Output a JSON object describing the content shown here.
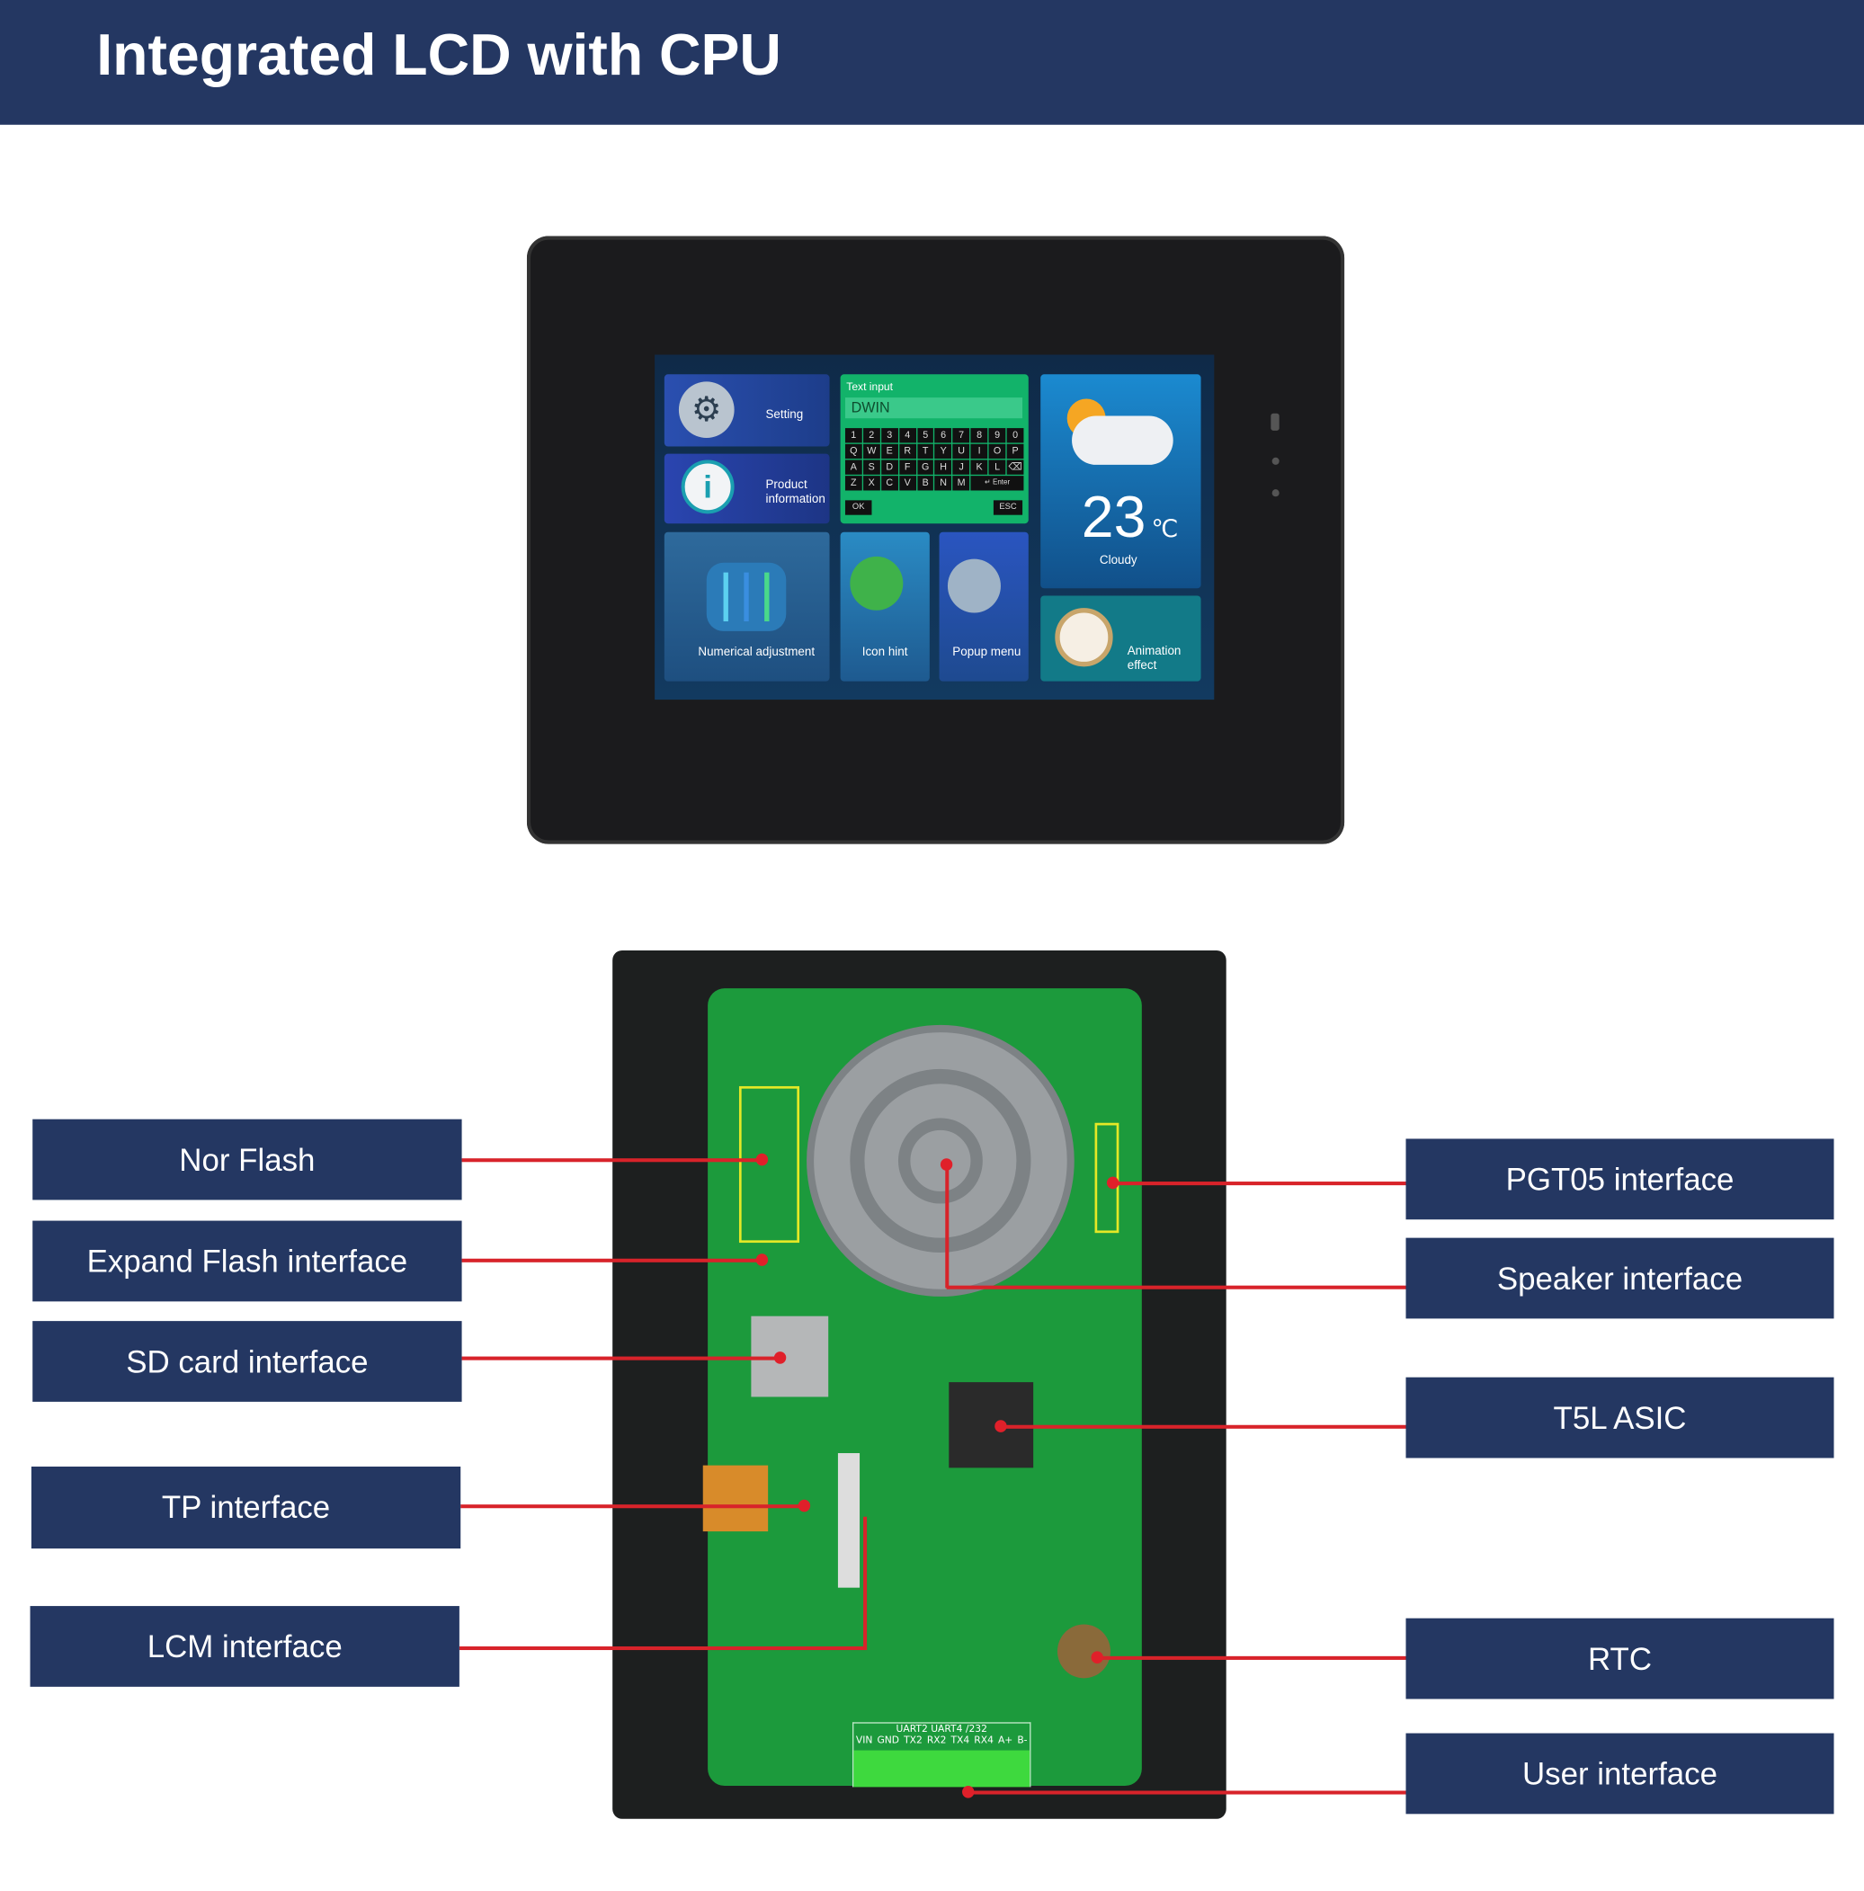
{
  "header": {
    "title": "Integrated LCD with CPU"
  },
  "screen": {
    "setting": "Setting",
    "product_info": "Product information",
    "text_input_title": "Text input",
    "text_input_value": "DWIN",
    "keyboard": [
      "1",
      "2",
      "3",
      "4",
      "5",
      "6",
      "7",
      "8",
      "9",
      "0",
      "Q",
      "W",
      "E",
      "R",
      "T",
      "Y",
      "U",
      "I",
      "O",
      "P",
      "A",
      "S",
      "D",
      "F",
      "G",
      "H",
      "J",
      "K",
      "L",
      "⌫",
      "Z",
      "X",
      "C",
      "V",
      "B",
      "N",
      "M",
      "↵ Enter"
    ],
    "ok": "OK",
    "esc": "ESC",
    "temperature": "23",
    "temperature_unit": "℃",
    "weather": "Cloudy",
    "numerical_adjustment": "Numerical adjustment",
    "icon_hint": "Icon hint",
    "popup_menu": "Popup menu",
    "animation_effect": "Animation effect"
  },
  "board": {
    "terminal_group": "UART2 UART4 /232",
    "terminal_pins": [
      "VIN",
      "GND",
      "TX2",
      "RX2",
      "TX4",
      "RX4",
      "A+",
      "B-"
    ]
  },
  "labels_left": [
    "Nor Flash",
    "Expand Flash interface",
    "SD card interface",
    "TP interface",
    "LCM interface"
  ],
  "labels_right": [
    "PGT05 interface",
    "Speaker interface",
    "T5L ASIC",
    "RTC",
    "User interface"
  ],
  "colors": {
    "banner": "#243762",
    "callout_line": "#d8232a",
    "pcb": "#1c9a3c"
  }
}
